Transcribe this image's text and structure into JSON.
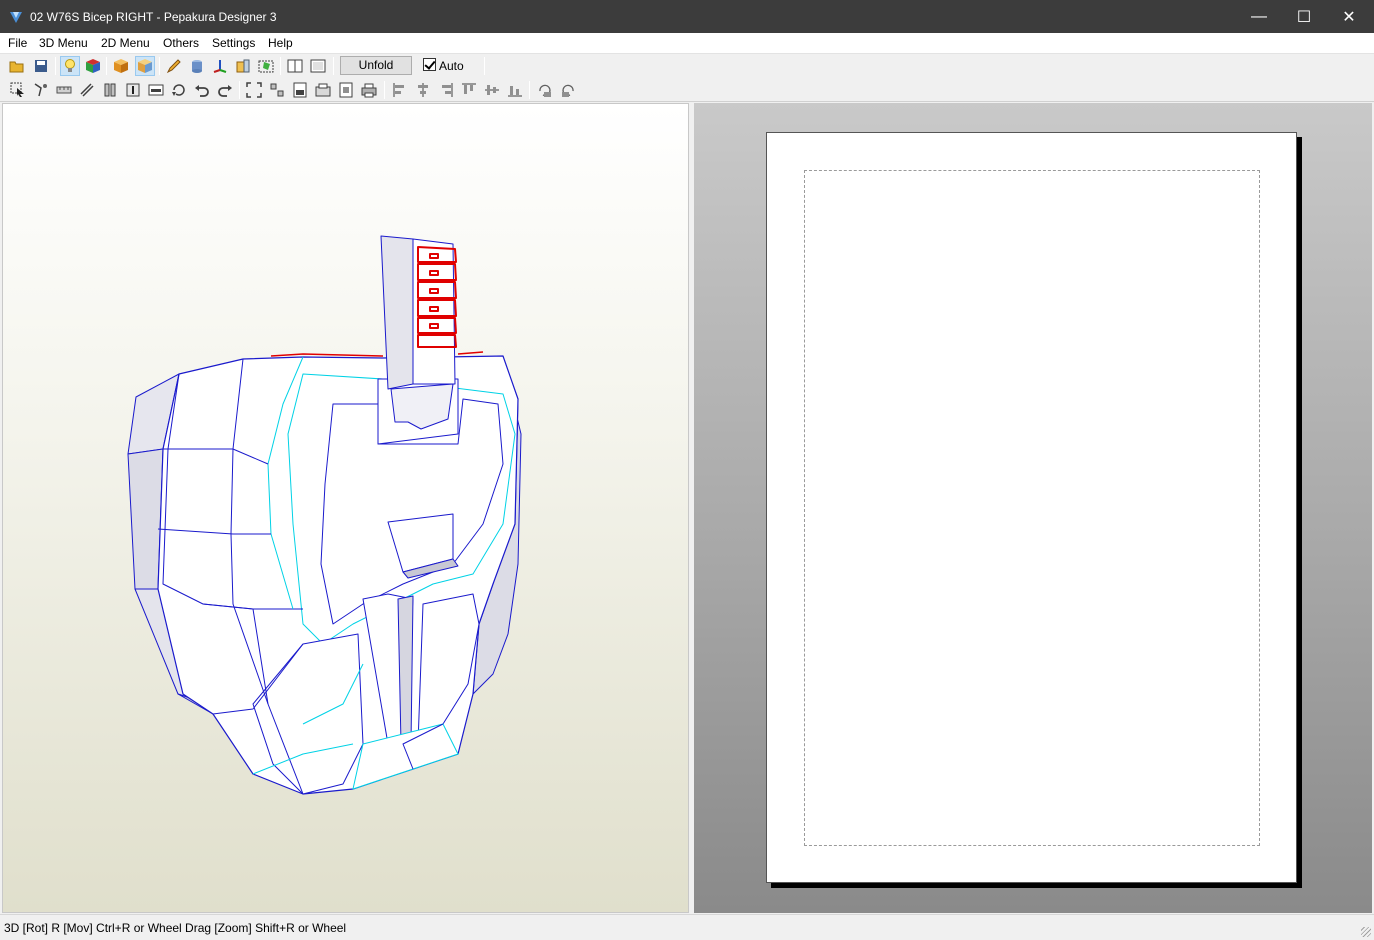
{
  "window": {
    "title": "02 W76S Bicep RIGHT - Pepakura Designer 3",
    "minimize_glyph": "—",
    "maximize_glyph": "☐",
    "close_glyph": "✕"
  },
  "menu": {
    "file": "File",
    "menu3d": "3D Menu",
    "menu2d": "2D Menu",
    "others": "Others",
    "settings": "Settings",
    "help": "Help"
  },
  "toolbar": {
    "unfold_label": "Unfold",
    "auto_label": "Auto",
    "auto_checked": true,
    "icons_row1": [
      "open-icon",
      "save-icon",
      "light-bulb-icon",
      "texture-cube-icon",
      "cube-orange-icon",
      "cube-view-icon",
      "pencil-edge-icon",
      "cylinder-icon",
      "axis-icon",
      "part-icon",
      "flap-icon",
      "window-single-icon",
      "window-split-icon"
    ],
    "icons_row2": [
      "select-icon",
      "path-icon",
      "ruler-icon",
      "edge-lines-icon",
      "split-part-icon",
      "text-icon",
      "image-icon",
      "rotate-part-icon",
      "undo-icon",
      "redo-icon",
      "fit-icon",
      "join-icon",
      "page-number-icon",
      "page-setup-icon",
      "zoom-page-icon",
      "print-icon",
      "align-left-icon",
      "align-center-icon",
      "align-right-icon",
      "align-top-icon",
      "align-middle-icon",
      "align-bottom-icon",
      "rotate-30-icon",
      "rotate-90-icon"
    ]
  },
  "status": {
    "text": "3D [Rot] R [Mov] Ctrl+R or Wheel Drag [Zoom] Shift+R or Wheel"
  },
  "colors": {
    "edge": "#1a1acc",
    "fold": "#00d2e6",
    "selected": "#e00000"
  }
}
